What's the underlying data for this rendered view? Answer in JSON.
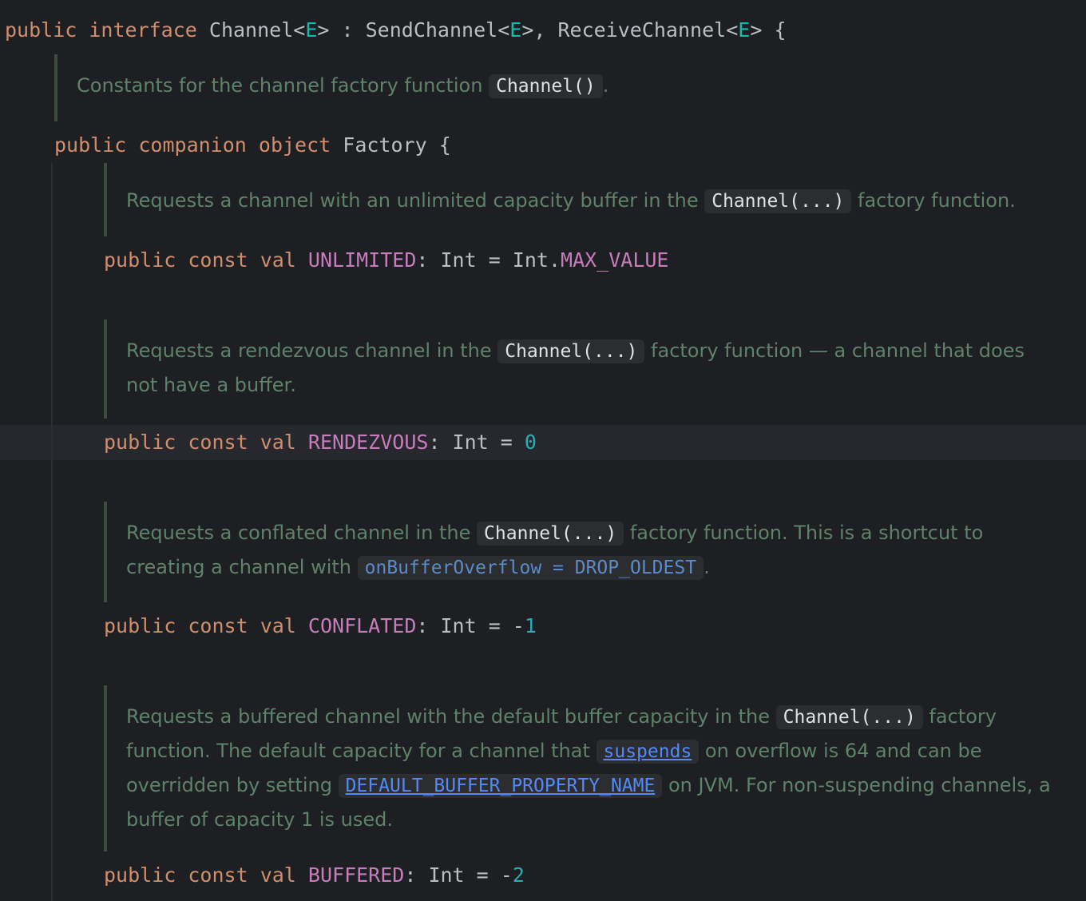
{
  "interface_decl": {
    "kw_public": "public",
    "kw_interface": "interface",
    "name": "Channel",
    "lt1": "<",
    "tp1": "E",
    "gt1": ">",
    "colon": " : ",
    "send": "SendChannel",
    "lt2": "<",
    "tp2": "E",
    "gt2": ">,",
    "receive": " ReceiveChannel",
    "lt3": "<",
    "tp3": "E",
    "gt3": ">",
    "brace": " {"
  },
  "doc_factory": {
    "text": "Constants for the channel factory function ",
    "code": "Channel()",
    "end": "."
  },
  "companion": {
    "kw_public": "public",
    "kw_companion": "companion",
    "kw_object": "object",
    "name": "Factory",
    "brace": " {"
  },
  "doc_unlimited": {
    "text": "Requests a channel with an unlimited capacity buffer in the ",
    "code": "Channel(...)",
    "end": " factory function."
  },
  "decl_unlimited": {
    "kw_public": "public",
    "kw_const": "const",
    "kw_val": "val",
    "name": "UNLIMITED",
    "type": ": Int = Int.",
    "value": "MAX_VALUE"
  },
  "doc_rendezvous": {
    "text": "Requests a rendezvous channel in the ",
    "code": "Channel(...)",
    "end": " factory function — a channel that does not have a buffer."
  },
  "decl_rendezvous": {
    "kw_public": "public",
    "kw_const": "const",
    "kw_val": "val",
    "name": "RENDEZVOUS",
    "type": ": Int = ",
    "value": "0"
  },
  "doc_conflated": {
    "text": "Requests a conflated channel in the ",
    "code": "Channel(...)",
    "mid": " factory function. This is a shortcut to creating a channel with ",
    "code2": "onBufferOverflow = DROP_OLDEST",
    "end": "."
  },
  "decl_conflated": {
    "kw_public": "public",
    "kw_const": "const",
    "kw_val": "val",
    "name": "CONFLATED",
    "type": ": Int = -",
    "value": "1"
  },
  "doc_buffered": {
    "text": "Requests a buffered channel with the default buffer capacity in the ",
    "code": "Channel(...)",
    "mid": " factory function. The default capacity for a channel that ",
    "link1": "suspends",
    "mid2": " on overflow is 64 and can be overridden by setting ",
    "link2": "DEFAULT_BUFFER_PROPERTY_NAME",
    "end": " on JVM. For non-suspending channels, a buffer of capacity 1 is used."
  },
  "decl_buffered": {
    "kw_public": "public",
    "kw_const": "const",
    "kw_val": "val",
    "name": "BUFFERED",
    "type": ": Int = -",
    "value": "2"
  },
  "colors": {
    "background": "#1e1f22",
    "keyword": "#cf8e6d",
    "constant": "#c77dbb",
    "number": "#2aacb8",
    "doc_text": "#5f826b"
  }
}
